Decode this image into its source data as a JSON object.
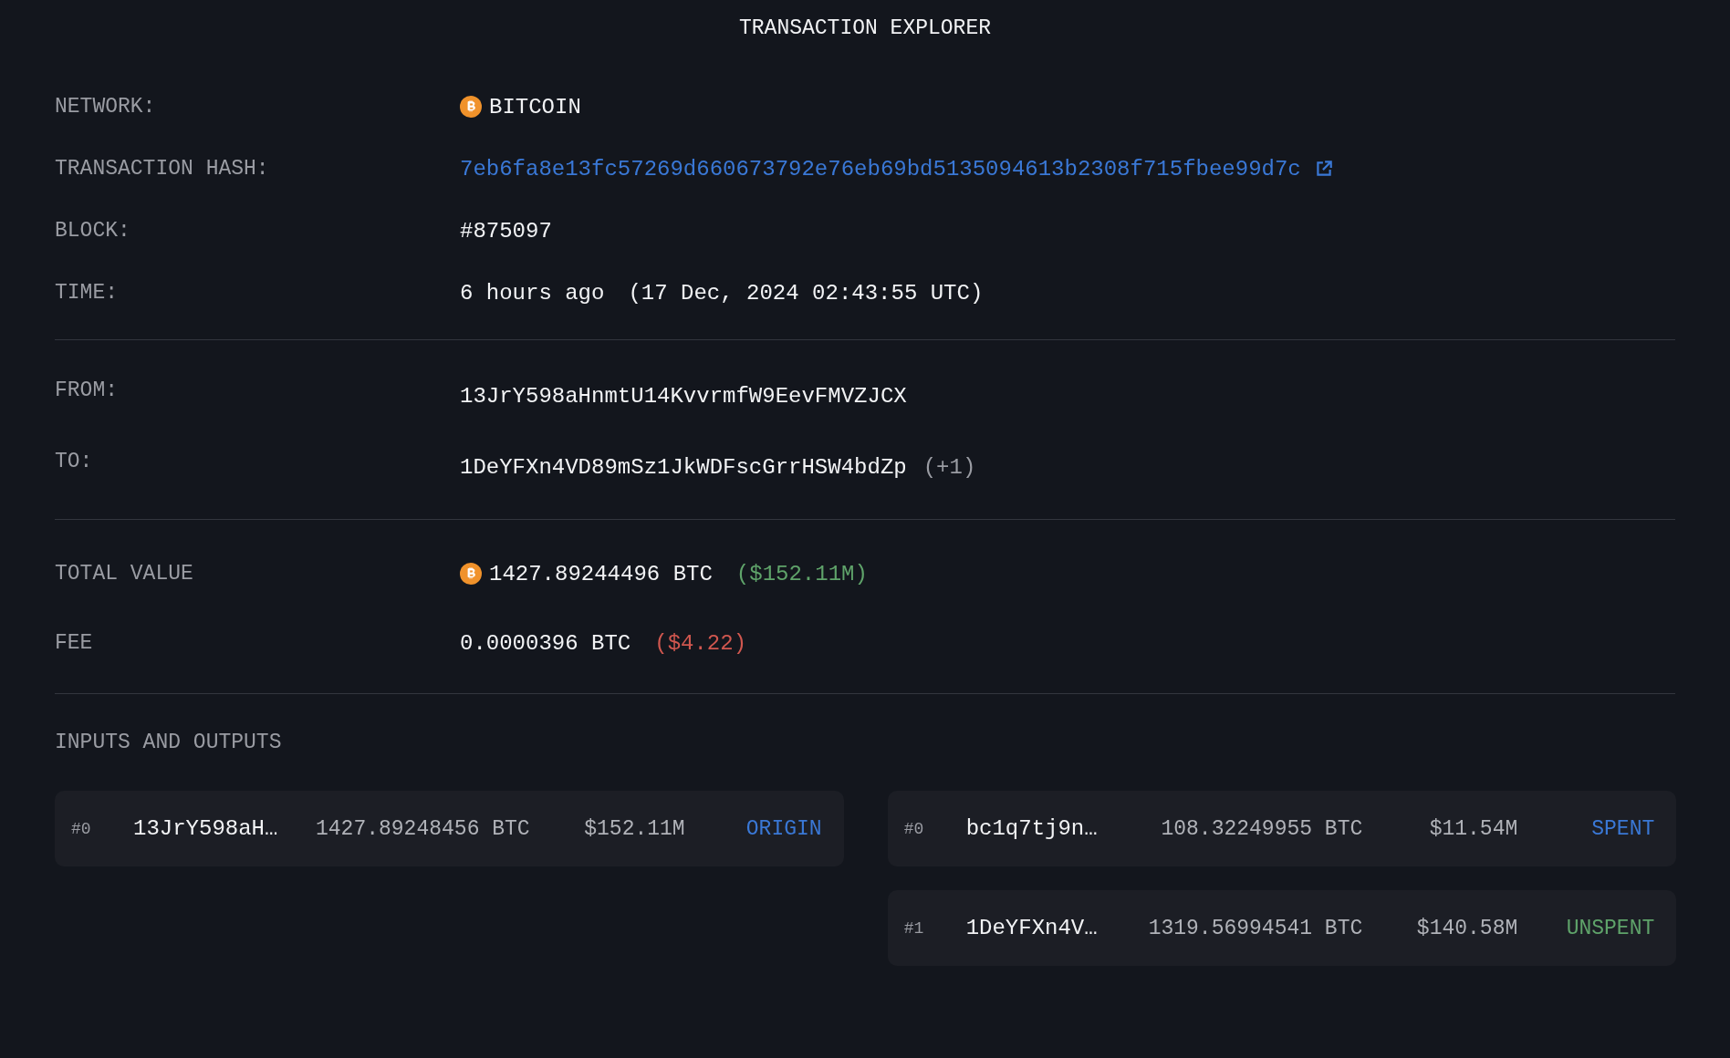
{
  "title": "TRANSACTION EXPLORER",
  "details": [
    {
      "kind": "network",
      "label": "NETWORK:",
      "value": "BITCOIN"
    },
    {
      "kind": "link",
      "label": "TRANSACTION HASH:",
      "value": "7eb6fa8e13fc57269d660673792e76eb69bd5135094613b2308f715fbee99d7c"
    },
    {
      "kind": "plain",
      "label": "BLOCK:",
      "value": "#875097"
    },
    {
      "kind": "plain",
      "label": "TIME:",
      "value": "6 hours ago",
      "extra": "(17 Dec, 2024 02:43:55 UTC)"
    }
  ],
  "parties": [
    {
      "label": "FROM:",
      "value": "13JrY598aHnmtU14KvvrmfW9EevFMVZJCX"
    },
    {
      "label": "TO:",
      "value": "1DeYFXn4VD89mSz1JkWDFscGrrHSW4bdZp",
      "extra": "(+1)"
    }
  ],
  "totals": [
    {
      "kind": "coin",
      "label": "TOTAL VALUE",
      "value": "1427.89244496 BTC",
      "usd": "($152.11M)",
      "color": "#5fa36a"
    },
    {
      "kind": "plain",
      "label": "FEE",
      "value": "0.0000396 BTC",
      "usd": "($4.22)",
      "color": "#d0574f"
    }
  ],
  "io_heading": "INPUTS AND OUTPUTS",
  "inputs": [
    {
      "index": "#0",
      "address": "13JrY598aH…",
      "amount": "1427.89248456 BTC",
      "usd": "$152.11M",
      "status": "ORIGIN",
      "color": "#3a78d6"
    }
  ],
  "outputs": [
    {
      "index": "#0",
      "address": "bc1q7tj9n…",
      "amount": "108.32249955 BTC",
      "usd": "$11.54M",
      "status": "SPENT",
      "color": "#3a78d6"
    },
    {
      "index": "#1",
      "address": "1DeYFXn4V…",
      "amount": "1319.56994541 BTC",
      "usd": "$140.58M",
      "status": "UNSPENT",
      "color": "#5fa36a"
    }
  ]
}
